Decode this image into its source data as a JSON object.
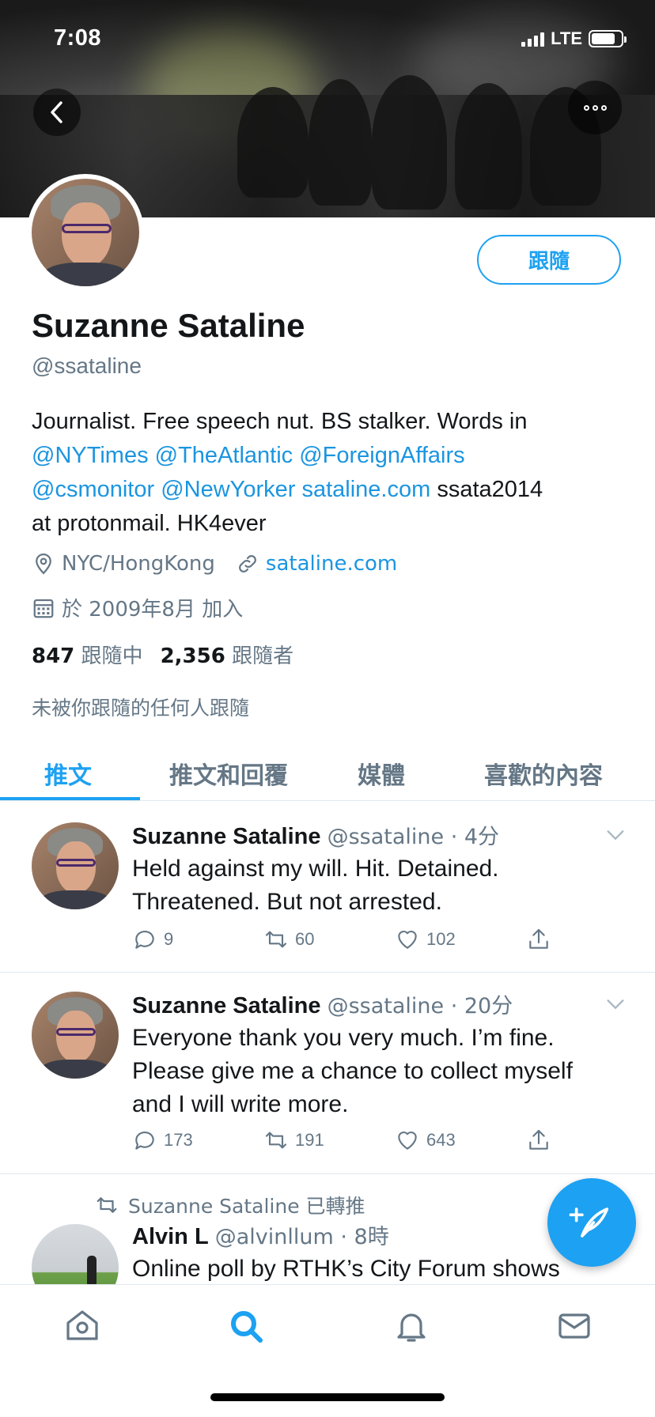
{
  "status": {
    "time": "7:08",
    "network": "LTE",
    "battery_level": 0.8
  },
  "profile": {
    "name": "Suzanne Sataline",
    "handle": "@ssataline",
    "follow_label": "跟隨",
    "bio_text_1": "Journalist. Free speech nut. BS stalker. Words in",
    "bio_links_1": "@NYTimes @TheAtlantic @ForeignAffairs",
    "bio_links_2": "@csmonitor @NewYorker sataline.com",
    "bio_text_2": " ssata2014",
    "bio_text_3": "at protonmail. HK4ever",
    "location": "NYC/HongKong",
    "website": "sataline.com",
    "joined": "於 2009年8月 加入",
    "following_count": "847",
    "following_label": "跟隨中",
    "followers_count": "2,356",
    "followers_label": "跟隨者",
    "not_followed": "未被你跟隨的任何人跟隨"
  },
  "tabs": [
    {
      "label": "推文",
      "active": true
    },
    {
      "label": "推文和回覆",
      "active": false
    },
    {
      "label": "媒體",
      "active": false
    },
    {
      "label": "喜歡的內容",
      "active": false
    }
  ],
  "tweets": [
    {
      "name": "Suzanne Sataline",
      "meta": "@ssataline · 4分",
      "line1": "Held against my will. Hit. Detained.",
      "line2": "Threatened. But not arrested.",
      "line3": "",
      "replies": "9",
      "retweets": "60",
      "likes": "102"
    },
    {
      "name": "Suzanne Sataline",
      "meta": "@ssataline · 20分",
      "line1": "Everyone thank you very much. I’m fine.",
      "line2": "Please give me a chance to collect myself",
      "line3": "and I will write more.",
      "replies": "173",
      "retweets": "191",
      "likes": "643"
    },
    {
      "retweeted_by": "Suzanne Sataline 已轉推",
      "name": "Alvin L",
      "meta": "@alvinllum · 8時",
      "line1": "Online poll by RTHK’s City Forum shows"
    }
  ],
  "nav": [
    "home-icon",
    "search-icon",
    "notifications-icon",
    "messages-icon"
  ],
  "colors": {
    "accent": "#1da1f2",
    "link": "#1b95e0",
    "muted": "#657786"
  }
}
